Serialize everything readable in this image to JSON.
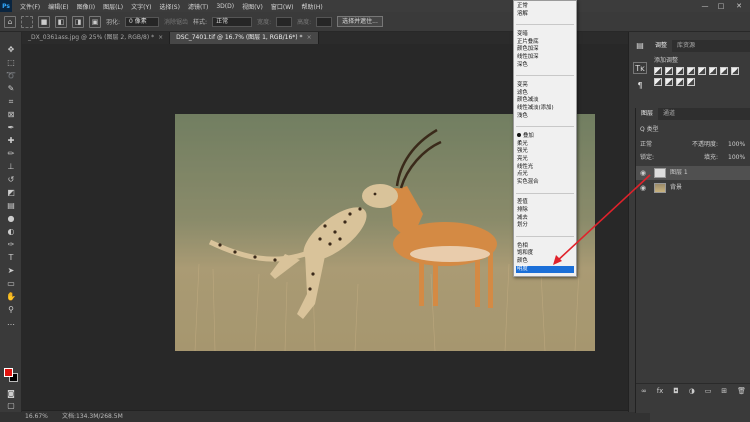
{
  "app": {
    "logo": "Ps"
  },
  "menubar": {
    "items": [
      "文件(F)",
      "编辑(E)",
      "图像(I)",
      "图层(L)",
      "文字(Y)",
      "选择(S)",
      "滤镜(T)",
      "3D(D)",
      "视图(V)",
      "窗口(W)",
      "帮助(H)"
    ]
  },
  "window_controls": {
    "minimize": "—",
    "maximize": "□",
    "close": "✕"
  },
  "options": {
    "feather_label": "羽化:",
    "feather_value": "0 像素",
    "antialias_label": "消除锯齿",
    "style_label": "样式:",
    "style_value": "正常",
    "width_label": "宽度:",
    "height_label": "高度:",
    "select_mask_button": "选择并遮住..."
  },
  "tabs": [
    {
      "label": "_DX_0361ass.jpg @ 25% (图层 2, RGB/8) *",
      "close": "×"
    },
    {
      "label": "DSC_7401.tif @ 16.7% (图层 1, RGB/16*) *",
      "close": "×"
    }
  ],
  "status": {
    "zoom": "16.67%",
    "doc": "文档:134.3M/268.5M"
  },
  "panels": {
    "adjust_tabs": [
      "调整",
      "库资源"
    ],
    "adjust_label": "添加调整",
    "layers_tabs": [
      "图层",
      "通道"
    ],
    "kind_filter": "Q 类型",
    "blend_mode": "正常",
    "opacity_label": "不透明度:",
    "opacity_value": "100%",
    "lock_label": "锁定:",
    "fill_label": "填充:",
    "fill_value": "100%",
    "layers": [
      {
        "name": "图层 1"
      },
      {
        "name": "背景"
      }
    ]
  },
  "blend_menu": {
    "groups": [
      [
        "正常",
        "溶解"
      ],
      [
        "变暗",
        "正片叠底",
        "颜色加深",
        "线性加深",
        "深色"
      ],
      [
        "变亮",
        "滤色",
        "颜色减淡",
        "线性减淡(添加)",
        "浅色"
      ],
      [
        "叠加",
        "柔光",
        "强光",
        "亮光",
        "线性光",
        "点光",
        "实色混合"
      ],
      [
        "差值",
        "排除",
        "减去",
        "划分"
      ],
      [
        "色相",
        "饱和度",
        "颜色",
        "明度"
      ]
    ],
    "selected": "明度"
  },
  "colors": {
    "accent": "#1b6fd8",
    "foreground": "#e0140f",
    "background": "#000000",
    "arrow": "#e0222b"
  }
}
